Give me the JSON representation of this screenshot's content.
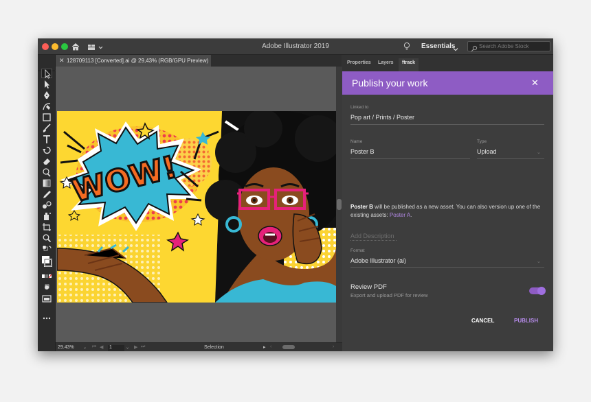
{
  "window": {
    "title": "Adobe Illustrator 2019"
  },
  "titlebar": {
    "workspace_label": "Essentials",
    "search_placeholder": "Search Adobe Stock"
  },
  "document": {
    "tab_label": "128709113 [Converted].ai @ 29,43% (RGB/GPU Preview)"
  },
  "statusbar": {
    "zoom": "29.43%",
    "page": "1",
    "mode": "Selection"
  },
  "panel": {
    "tabs": [
      {
        "label": "Properties",
        "active": false
      },
      {
        "label": "Layers",
        "active": false
      },
      {
        "label": "ftrack",
        "active": true
      }
    ],
    "header_title": "Publish your work",
    "linked_to_label": "Linked to",
    "linked_to_value": "Pop art / Prints / Poster",
    "name_label": "Name",
    "name_value": "Poster B",
    "type_label": "Type",
    "type_value": "Upload",
    "info_name": "Poster B",
    "info_text": " will be published as a new asset. You can also version up one of the existing assets: ",
    "info_link": "Poster A",
    "info_end": ".",
    "description_placeholder": "Add Description",
    "format_label": "Format",
    "format_value": "Adobe Illustrator (ai)",
    "review_title": "Review PDF",
    "review_sub": "Export and upload PDF for review",
    "review_enabled": true,
    "cancel_label": "CANCEL",
    "publish_label": "PUBLISH"
  },
  "artwork": {
    "text": "WOW!"
  },
  "colors": {
    "accent": "#8e5cc4",
    "link": "#b48ae8",
    "panel_bg": "#3d3d3d",
    "canvas_bg": "#5a5a5a"
  }
}
